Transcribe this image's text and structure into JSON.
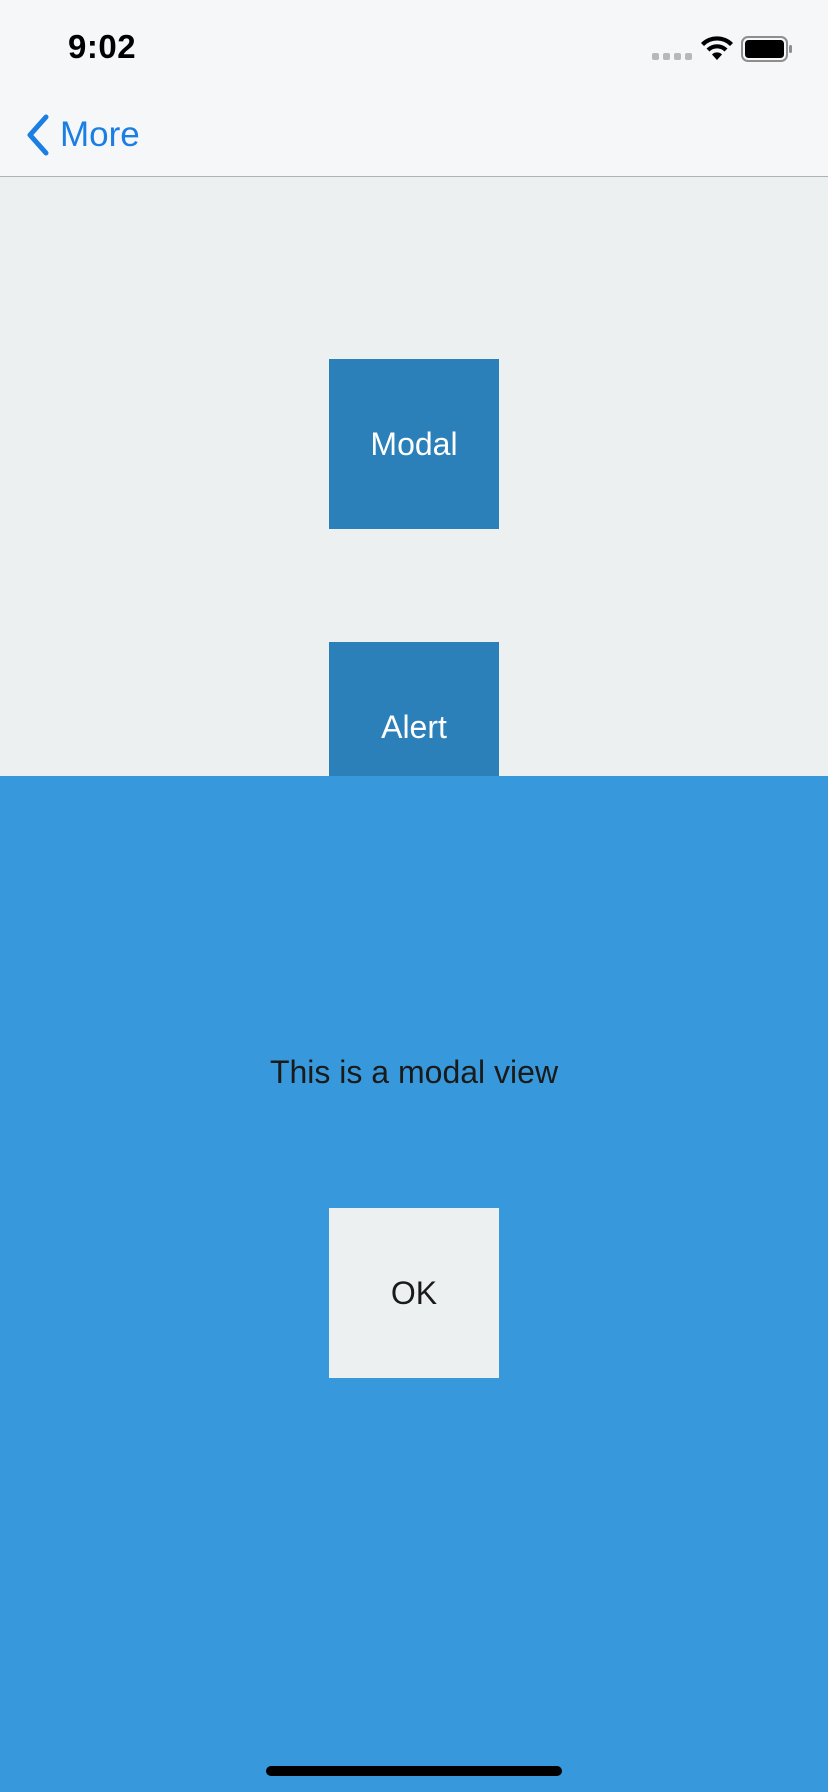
{
  "status_bar": {
    "time": "9:02"
  },
  "nav": {
    "back_label": "More"
  },
  "main": {
    "modal_button_label": "Modal",
    "alert_button_label": "Alert"
  },
  "modal": {
    "message": "This is a modal view",
    "ok_button_label": "OK"
  },
  "colors": {
    "accent": "#1a7ee3",
    "button_bg": "#2b80b9",
    "modal_bg": "#3799db",
    "page_bg": "#ecf0f1"
  },
  "icons": [
    "signal-icon",
    "wifi-icon",
    "battery-icon",
    "back-chevron-icon"
  ]
}
